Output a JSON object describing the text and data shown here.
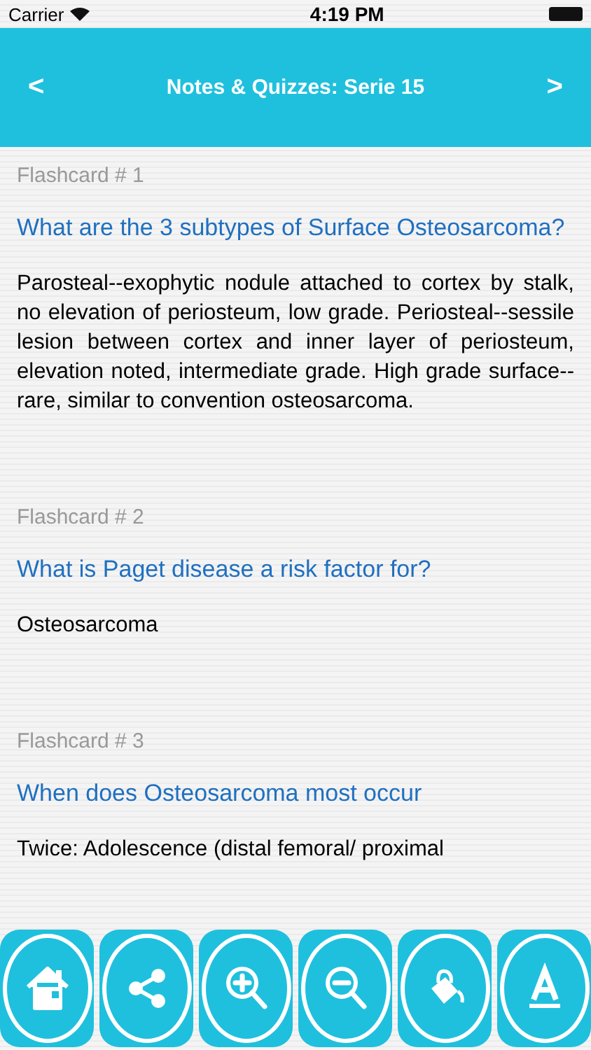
{
  "status_bar": {
    "carrier": "Carrier",
    "time": "4:19 PM"
  },
  "header": {
    "title": "Notes & Quizzes: Serie 15",
    "prev": "<",
    "next": ">"
  },
  "cards": [
    {
      "label": "Flashcard # 1",
      "question": "What are the 3 subtypes of Surface Osteosarcoma?",
      "answer": "Parosteal--exophytic nodule attached to cortex by stalk, no elevation of periosteum, low grade. Periosteal--sessile lesion between cortex and inner layer of periosteum, elevation noted, intermediate grade. High grade surface--rare, similar to convention osteosarcoma."
    },
    {
      "label": "Flashcard # 2",
      "question": "What is Paget disease a risk factor for?",
      "answer": "Osteosarcoma"
    },
    {
      "label": "Flashcard # 3",
      "question": "When does Osteosarcoma most occur",
      "answer": "Twice: Adolescence (distal femoral/ proximal"
    }
  ],
  "toolbar": [
    {
      "kind": "home"
    },
    {
      "kind": "share"
    },
    {
      "kind": "zoom-in"
    },
    {
      "kind": "zoom-out"
    },
    {
      "kind": "paint"
    },
    {
      "kind": "font"
    }
  ]
}
